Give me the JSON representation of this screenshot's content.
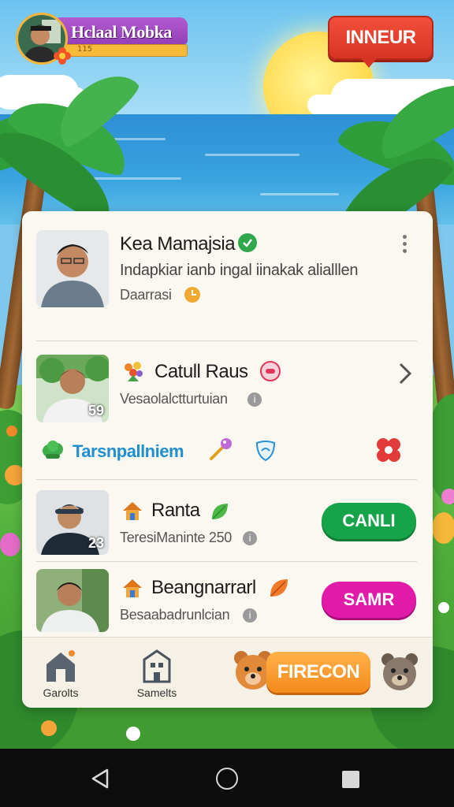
{
  "player": {
    "name": "Hclaal Mobka",
    "xp_label": "115"
  },
  "top_button": {
    "label": "INNEUR"
  },
  "rows": [
    {
      "name": "Kea Mamajsia",
      "line1": "Indapkiar ianb ingal iinakak alialllen",
      "line2": "Daarrasi"
    },
    {
      "name": "Catull Raus",
      "line1": "Vesaolalctturtuian",
      "photo_number": "59"
    },
    {
      "name": "Ranta",
      "line1": "TeresiManinte 250",
      "photo_number": "23",
      "button_label": "CANLI"
    },
    {
      "name": "Beangnarrarl",
      "line1": "Besaabadrunlcian",
      "button_label": "SAMR"
    }
  ],
  "tool_row": {
    "label": "Tarsnpallniem"
  },
  "bottom_nav": {
    "item1": "Garolts",
    "item2": "Samelts",
    "main_button": "FIRECON"
  },
  "colors": {
    "green_button": "#16a34a",
    "pink_button": "#e21aa8",
    "orange_button": "#f58a1c",
    "link_blue": "#1f8fd0"
  }
}
